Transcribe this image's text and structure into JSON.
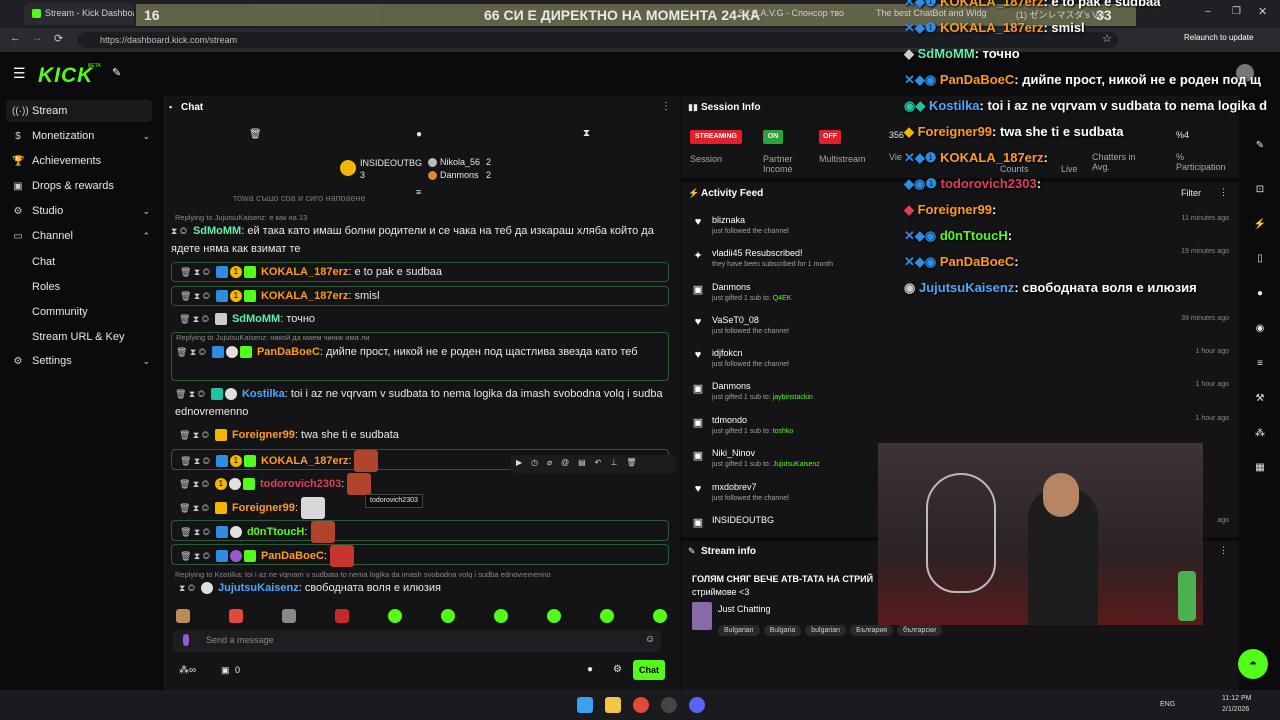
{
  "browser": {
    "tabs": [
      {
        "label": "Stream - Kick Dashboard"
      },
      {
        "label": "16"
      },
      {
        "label": "66 СИ Е ДИРЕКТНО НА МОМЕНТА 24-КА"
      },
      {
        "label": "S.I.C.A.V.G - Спонсор тво"
      },
      {
        "label": "The best ChatBot and Widg"
      },
      {
        "label": "(1) ゼンレマスダ's Video"
      },
      {
        "label": "33"
      }
    ],
    "url": "https://dashboard.kick.com/stream",
    "relaunch_label": "Relaunch to update"
  },
  "kick": {
    "logo": "KICK",
    "beta": "BETA"
  },
  "sidebar": {
    "items": [
      {
        "label": "Stream",
        "icon": "broadcast-icon"
      },
      {
        "label": "Monetization",
        "icon": "dollar-icon"
      },
      {
        "label": "Achievements",
        "icon": "trophy-icon"
      },
      {
        "label": "Drops & rewards",
        "icon": "gift-icon"
      },
      {
        "label": "Studio",
        "icon": "gear-icon"
      },
      {
        "label": "Channel",
        "icon": "monitor-icon"
      },
      {
        "label": "Settings",
        "icon": "cog-icon"
      }
    ],
    "channel_sub": [
      "Chat",
      "Roles",
      "Community",
      "Stream URL & Key"
    ]
  },
  "chat": {
    "title": "Chat",
    "pinned": {
      "user1": "INSIDEOUTBG",
      "user1_count": "3",
      "user2": "Nikola_56",
      "user2_count": "2",
      "user3": "Danmons",
      "user3_count": "2"
    },
    "top_partial": "тоwa също сра и сиго напраене",
    "messages": [
      {
        "reply": "Replying to JujutsuKaisenz: е как на 13",
        "user": "SdMoMM",
        "color": "#5ef0a8",
        "text": "ей така като имаш болни родители и се чака на теб да изкараш хляба който да ядете няма как взимат те",
        "boxed": false
      },
      {
        "user": "KOKALA_187erz",
        "color": "#ff9a1f",
        "text": "e to pak e sudbaa",
        "boxed": true
      },
      {
        "user": "KOKALA_187erz",
        "color": "#ff9a1f",
        "text": "smisl",
        "boxed": true
      },
      {
        "user": "SdMoMM",
        "color": "#5ef0a8",
        "text": "точно",
        "boxed": false
      },
      {
        "reply": "Replying to JujutsuKaisenz: някой да мяем чиник има ли",
        "user": "PanDaBoeC",
        "color": "#ff9a1f",
        "text": "дийпе прост, никой не е роден под щастлива звезда като теб",
        "boxed": true
      },
      {
        "user": "Kostilka",
        "color": "#4aa8ff",
        "text": "toi i az ne vqrvam v sudbata to nema logika da imash svobodna volq i sudba ednovremenno",
        "boxed": false
      },
      {
        "user": "Foreigner99",
        "color": "#ff9a1f",
        "text": "twa she ti e sudbata",
        "boxed": false
      },
      {
        "user": "KOKALA_187erz",
        "color": "#ff9a1f",
        "text": "",
        "boxed": true
      },
      {
        "user": "todorovich2303",
        "color": "#e23d5e",
        "text": "",
        "boxed": false
      },
      {
        "user": "Foreigner99",
        "color": "#ff9a1f",
        "text": "",
        "boxed": false
      },
      {
        "user": "d0nTtoucH",
        "color": "#53fc18",
        "text": "",
        "boxed": true
      },
      {
        "user": "PanDaBoeC",
        "color": "#ff9a1f",
        "text": "",
        "boxed": true
      },
      {
        "reply": "Replying to Kostilka: toi i az ne vqrvam v sudbata to nema logika da imash svobodna volq i sudba ednovremenno",
        "user": "JujutsuKaisenz",
        "color": "#4aa8ff",
        "text": "свободната воля е илюзия",
        "boxed": false
      }
    ],
    "tooltip": "todorovich2303",
    "input_placeholder": "Send a message",
    "footer_count": "0",
    "send_label": "Chat"
  },
  "session": {
    "title": "Session Info",
    "statuses": [
      {
        "pill": "STREAMING",
        "label": "Session",
        "color": "#e0202a"
      },
      {
        "pill": "ON",
        "label": "Partner Income",
        "color": "#2fa13a"
      },
      {
        "pill": "OFF",
        "label": "Multistream",
        "color": "#e0202a"
      }
    ],
    "viewers_value": "356",
    "viewers_label": "Vie",
    "counts_label": "Counts",
    "live_label": "Live",
    "chatters_label": "Chatters in Avg.",
    "participation_value": "%4",
    "participation_label": "% Participation"
  },
  "activity": {
    "title": "Activity Feed",
    "filter_label": "Filter",
    "items": [
      {
        "name": "bliznaka",
        "sub": "just followed the channel",
        "time": "11 minutes ago",
        "icon": "heart-icon"
      },
      {
        "name": "vladii45 Resubscribed!",
        "sub": "they have been subscribed for 1 month",
        "time": "19 minutes ago",
        "icon": "star-icon"
      },
      {
        "name": "Danmons",
        "sub": "just gifted 1 sub to:",
        "highlight": "Q4EK",
        "time": "",
        "icon": "gift-icon"
      },
      {
        "name": "VaSeT0_08",
        "sub": "just followed the channel",
        "time": "39 minutes ago",
        "icon": "heart-icon"
      },
      {
        "name": "idjfokcn",
        "sub": "just followed the channel",
        "time": "1 hour ago",
        "icon": "heart-icon"
      },
      {
        "name": "Danmons",
        "sub": "just gifted 1 sub to:",
        "highlight": "jaybinstackin",
        "time": "1 hour ago",
        "icon": "gift-icon"
      },
      {
        "name": "tdmondo",
        "sub": "just gifted 1 sub to:",
        "highlight": "toshko",
        "time": "1 hour ago",
        "icon": "gift-icon"
      },
      {
        "name": "Niki_Ninov",
        "sub": "just gifted 1 sub to:",
        "highlight": "JujutsuKaisenz",
        "time": "",
        "icon": "gift-icon"
      },
      {
        "name": "mxdobrev7",
        "sub": "just followed the channel",
        "time": "",
        "icon": "heart-icon"
      },
      {
        "name": "INSIDEOUTBG",
        "sub": "",
        "time": "ago",
        "icon": "gift-icon"
      }
    ]
  },
  "stream_info": {
    "title": "Stream info",
    "stream_title": "ГОЛЯМ СНЯГ ВЕЧЕ АТВ-ТАТА НА СТРИЙ",
    "stream_title2": "стриймове <3",
    "category": "Just Chatting",
    "tags": [
      "Bulgarian",
      "Bulgaria",
      "bulgarian",
      "България",
      "български"
    ]
  },
  "overlay": [
    {
      "user": "KOKALA_187erz",
      "text": ": e to pak e sudbaa",
      "color": "#ff9a1f"
    },
    {
      "user": "KOKALA_187erz",
      "text": ": smisl",
      "color": "#ff9a1f"
    },
    {
      "user": "SdMoMM",
      "text": ": точно",
      "color": "#5ef0a8"
    },
    {
      "user": "PanDaBoeC",
      "text": ": дийпе прост, никой не е роден под щ",
      "color": "#ff9a1f"
    },
    {
      "user": "Kostilka",
      "text": ": toi i az ne vqrvam v sudbata to nema logika d",
      "color": "#4aa8ff"
    },
    {
      "user": "Foreigner99",
      "text": ": twa she ti e sudbata",
      "color": "#ff9a1f"
    },
    {
      "user": "KOKALA_187erz",
      "text": ":",
      "color": "#ff9a1f"
    },
    {
      "user": "todorovich2303",
      "text": ":",
      "color": "#e23d5e"
    },
    {
      "user": "Foreigner99",
      "text": ":",
      "color": "#ff9a1f"
    },
    {
      "user": "d0nTtoucH",
      "text": ":",
      "color": "#53fc18"
    },
    {
      "user": "PanDaBoeC",
      "text": ":",
      "color": "#ff9a1f"
    },
    {
      "user": "JujutsuKaisenz",
      "text": ": свободната воля е илюзия",
      "color": "#4aa8ff"
    }
  ],
  "taskbar": {
    "lang": "ENG",
    "time": "11:12 PM",
    "date": "2/1/2026"
  },
  "colors": {
    "accent": "#53fc18",
    "panel": "#141417",
    "bg": "#0b0b0d"
  }
}
